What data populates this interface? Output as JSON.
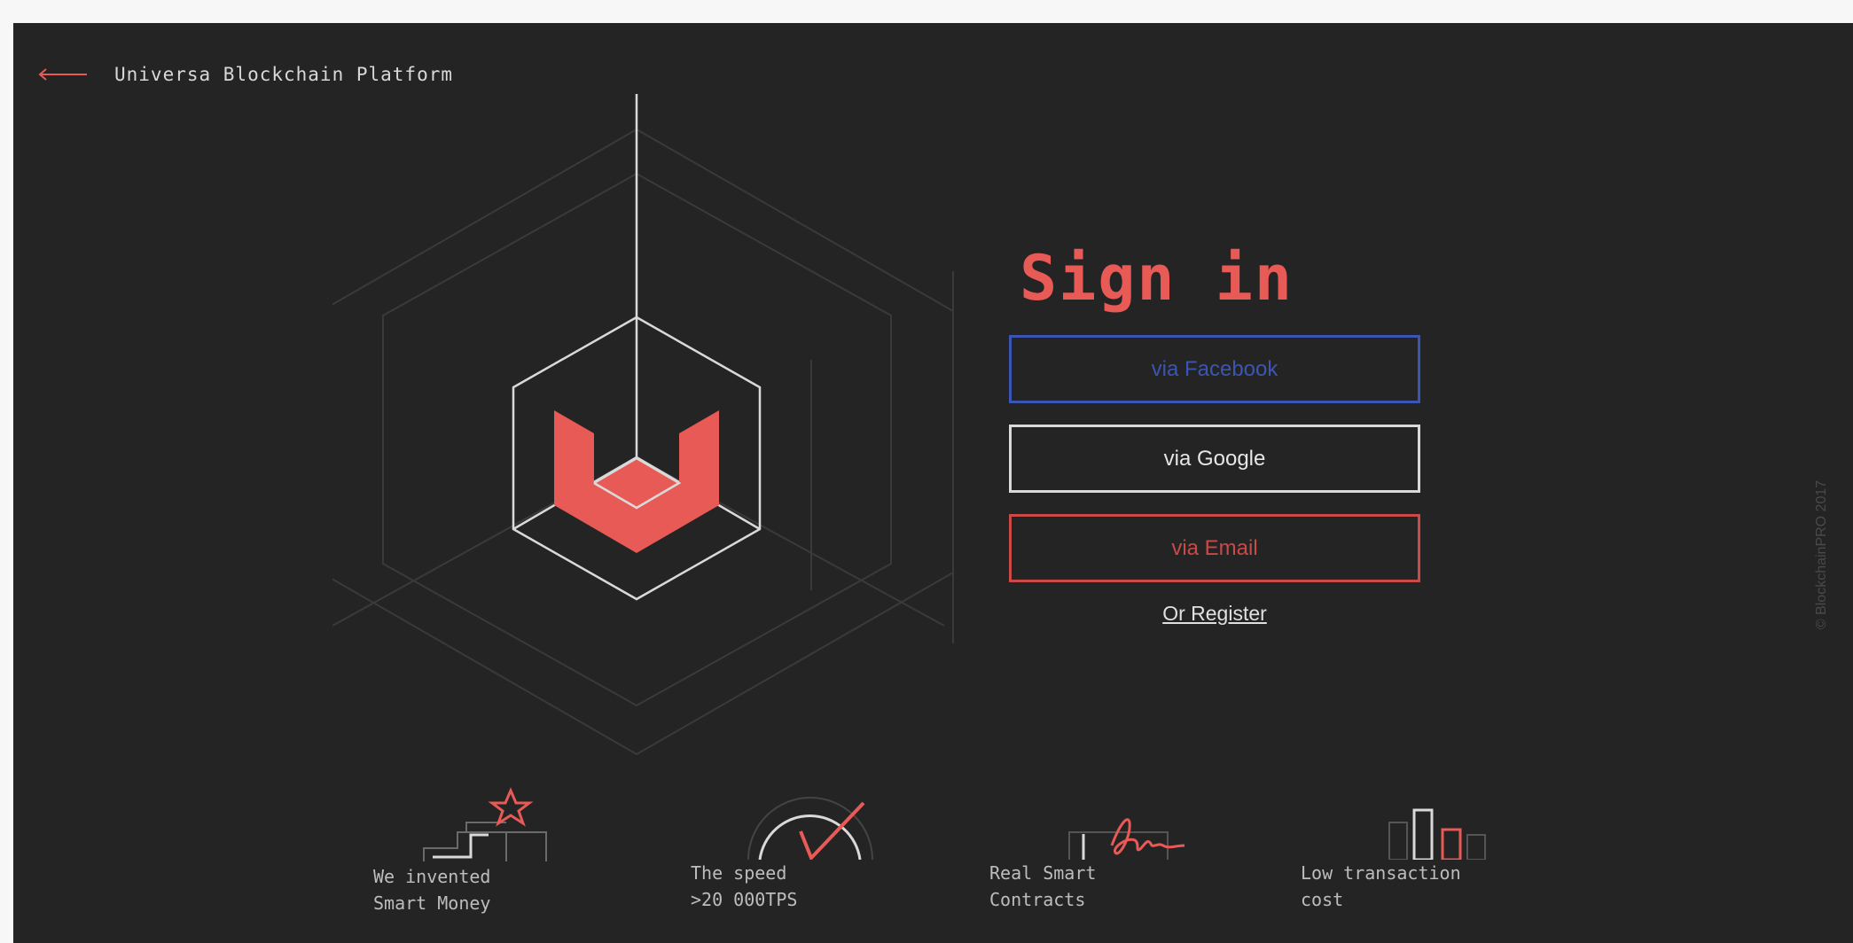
{
  "header": {
    "title": "Universa Blockchain Platform",
    "back_icon": "arrow-left-icon"
  },
  "signin": {
    "title": "Sign in",
    "buttons": [
      {
        "label": "via Facebook",
        "color": "#3b56b2"
      },
      {
        "label": "via Google",
        "color": "#d9d9d9"
      },
      {
        "label": "via Email",
        "color": "#c94a47"
      }
    ],
    "register_label": "Or Register"
  },
  "copyright": "© BlockchainPRO 2017",
  "features": [
    {
      "icon": "stairs-star-icon",
      "lines": [
        "We invented",
        "Smart Money"
      ]
    },
    {
      "icon": "speedometer-icon",
      "lines": [
        "The speed",
        ">20 000TPS"
      ]
    },
    {
      "icon": "signature-icon",
      "lines": [
        "Real Smart",
        "Contracts"
      ]
    },
    {
      "icon": "bar-chart-icon",
      "lines": [
        "Low transaction",
        "cost"
      ]
    }
  ],
  "colors": {
    "accent": "#e85a56",
    "background": "#242424",
    "facebook": "#3b56b2"
  }
}
